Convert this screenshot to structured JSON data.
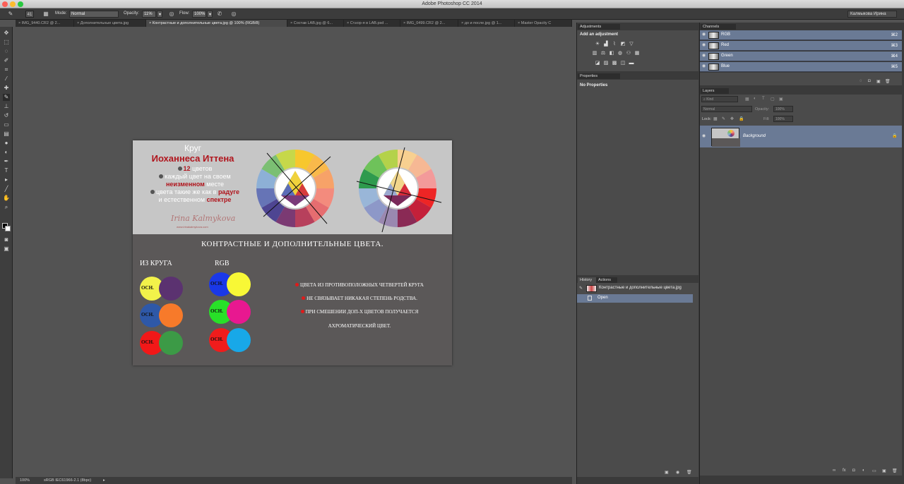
{
  "app": {
    "title": "Adobe Photoshop CC 2014",
    "user": "Калмыкова Ирина"
  },
  "options": {
    "mode_label": "Mode:",
    "mode_value": "Normal",
    "opacity_label": "Opacity:",
    "opacity_value": "11%",
    "flow_label": "Flow:",
    "flow_value": "100%",
    "brush_size": "41"
  },
  "tabs": [
    {
      "label": "IMG_9440.CR2 @ 2..."
    },
    {
      "label": "Дополнительные цвета.jpg"
    },
    {
      "label": "Контрастные и дополнительные цвета.jpg @ 100% (RGB/8)"
    },
    {
      "label": "Состав LAB.jpg @ 6..."
    },
    {
      "label": "Ст.кор-я в LAB.psd ..."
    },
    {
      "label": "IMG_0499.CR2 @ 2..."
    },
    {
      "label": "до и после.jpg @ 1..."
    },
    {
      "label": "Master Opacity C"
    }
  ],
  "image": {
    "krug": "Круг",
    "itten": "Иоханнеса Иттена",
    "line1_num": "12",
    "line1_rest": "цветов",
    "line2": "каждый цвет на своем",
    "line3_bold": "неизменном",
    "line3_rest": "месте",
    "line4_pre": "цвета такие же как в",
    "line4_bold": "радуге",
    "line5_pre": "и естественном",
    "line5_bold": "спектре",
    "signature": "Irina Kalmykova",
    "sig_url": "www.irinakalmykova.com",
    "main_title": "КОНТРАСТНЫЕ И ДОПОЛНИТЕЛЬНЫЕ ЦВЕТА.",
    "col_left": "ИЗ КРУГА",
    "col_right": "RGB",
    "osn": "ОСН.",
    "rule1": "ЦВЕТА ИЗ ПРОТИВОПОЛОЖНЫХ ЧЕТВЕРТЕЙ КРУГА",
    "rule2": "НЕ СВЯЗЫВАЕТ НИКАКАЯ СТЕПЕНЬ РОДСТВА.",
    "rule3": "ПРИ СМЕШЕНИИ ДОП-Х ЦВЕТОВ ПОЛУЧАЕТСЯ",
    "rule4": "АХРОМАТИЧЕСКИЙ ЦВЕТ."
  },
  "status": {
    "zoom": "100%",
    "profile": "sRGB IEC61966-2.1 (8bpc)"
  },
  "panels": {
    "adjustments": {
      "tab": "Adjustments",
      "heading": "Add an adjustment"
    },
    "properties": {
      "tab": "Properties",
      "text": "No Properties"
    },
    "channels": {
      "tab": "Channels",
      "rows": [
        {
          "label": "RGB",
          "key": "⌘2"
        },
        {
          "label": "Red",
          "key": "⌘3"
        },
        {
          "label": "Green",
          "key": "⌘4"
        },
        {
          "label": "Blue",
          "key": "⌘5"
        }
      ]
    },
    "layers": {
      "tab": "Layers",
      "kind": "Kind",
      "blend": "Normal",
      "opacity_label": "Opacity:",
      "opacity_value": "100%",
      "lock_label": "Lock:",
      "fill_label": "Fill:",
      "fill_value": "100%",
      "layer_name": "Background"
    },
    "history": {
      "tab1": "History",
      "tab2": "Actions",
      "doc": "Контрастные и дополнительные цвета.jpg",
      "step": "Open"
    }
  }
}
